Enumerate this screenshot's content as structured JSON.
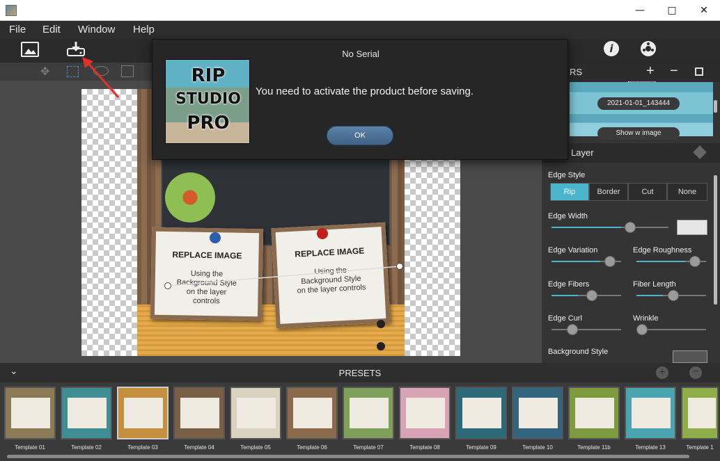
{
  "menu": {
    "file": "File",
    "edit": "Edit",
    "window": "Window",
    "help": "Help"
  },
  "layers": {
    "header": "RS",
    "items": [
      "2021-01-01_143444",
      "Show w image"
    ],
    "panel_title": "Layer"
  },
  "edge": {
    "style_label": "Edge Style",
    "styles": [
      "Rip",
      "Border",
      "Cut",
      "None"
    ],
    "selected_style": "Rip",
    "width_label": "Edge Width",
    "variation_label": "Edge Variation",
    "roughness_label": "Edge Roughness",
    "fibers_label": "Edge Fibers",
    "fiber_length_label": "Fiber Length",
    "curl_label": "Edge Curl",
    "wrinkle_label": "Wrinkle",
    "background_label": "Background Style"
  },
  "canvas": {
    "card1": {
      "heading": "REPLACE IMAGE",
      "body": "Using the Background Style on the layer controls"
    },
    "card2": {
      "heading": "REPLACE IMAGE",
      "body": "Using the Background Style on the layer controls"
    }
  },
  "presets": {
    "title": "PRESETS",
    "items": [
      "Template 01",
      "Template 02",
      "Template 03",
      "Template 04",
      "Template 05",
      "Template 06",
      "Template 07",
      "Template 08",
      "Template 09",
      "Template 10",
      "Template 11b",
      "Template 13",
      "Template 1"
    ],
    "selected": "Template 03"
  },
  "dialog": {
    "title": "No Serial",
    "message": "You need to activate the product before saving.",
    "ok_label": "OK",
    "logo_text": [
      "RIP",
      "STUDIO",
      "PRO"
    ]
  },
  "colors": {
    "accent": "#4bb5cc",
    "dialog_bg": "#262626",
    "arrow": "#e0312b"
  }
}
